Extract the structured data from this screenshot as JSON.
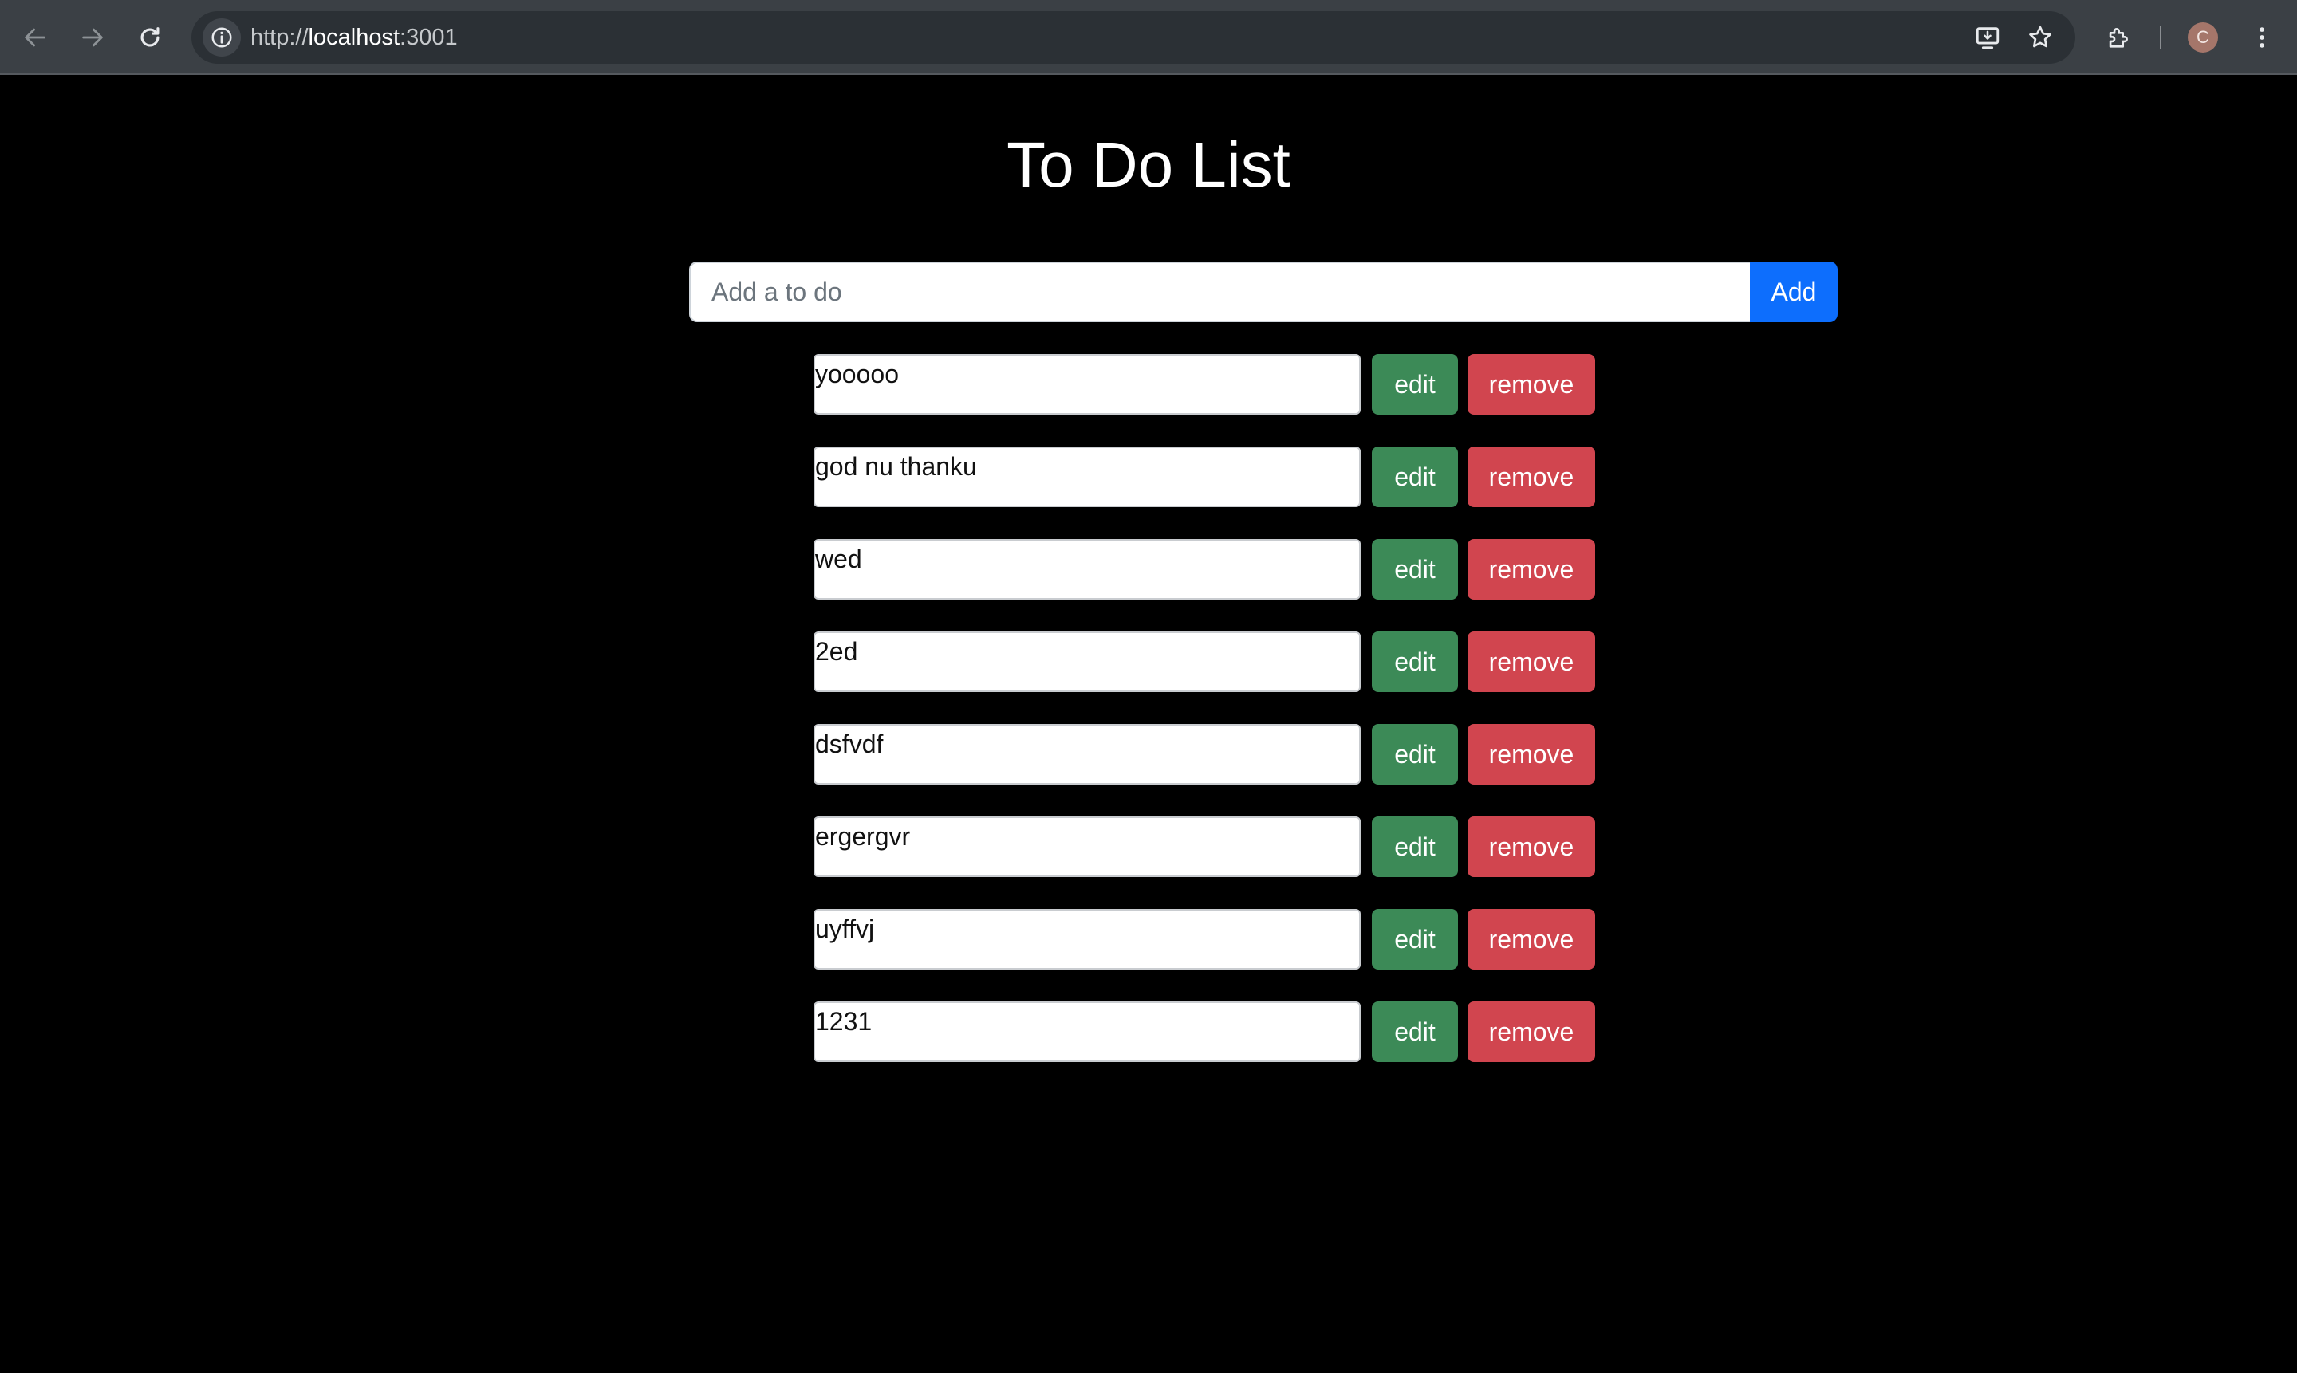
{
  "browser": {
    "url_scheme": "http://",
    "url_host": "localhost",
    "url_port": ":3001",
    "profile_initial": "C",
    "icons": [
      "back-arrow-icon",
      "forward-arrow-icon",
      "reload-icon",
      "site-info-icon",
      "install-app-icon",
      "bookmark-star-icon",
      "extensions-puzzle-icon",
      "kebab-menu-icon"
    ]
  },
  "page": {
    "title": "To Do List",
    "add_form": {
      "placeholder": "Add a to do",
      "value": "",
      "button_label": "Add"
    },
    "todos": [
      {
        "text": "yooooo",
        "edit_label": "edit",
        "remove_label": "remove"
      },
      {
        "text": "god nu thanku",
        "edit_label": "edit",
        "remove_label": "remove"
      },
      {
        "text": "wed",
        "edit_label": "edit",
        "remove_label": "remove"
      },
      {
        "text": "2ed",
        "edit_label": "edit",
        "remove_label": "remove"
      },
      {
        "text": "dsfvdf",
        "edit_label": "edit",
        "remove_label": "remove"
      },
      {
        "text": "ergergvr",
        "edit_label": "edit",
        "remove_label": "remove"
      },
      {
        "text": "uyffvj",
        "edit_label": "edit",
        "remove_label": "remove"
      },
      {
        "text": "1231",
        "edit_label": "edit",
        "remove_label": "remove"
      }
    ]
  },
  "colors": {
    "background": "#000000",
    "add_button": "#0d6efd",
    "edit_button": "#3c8a57",
    "remove_button": "#d1454f"
  }
}
